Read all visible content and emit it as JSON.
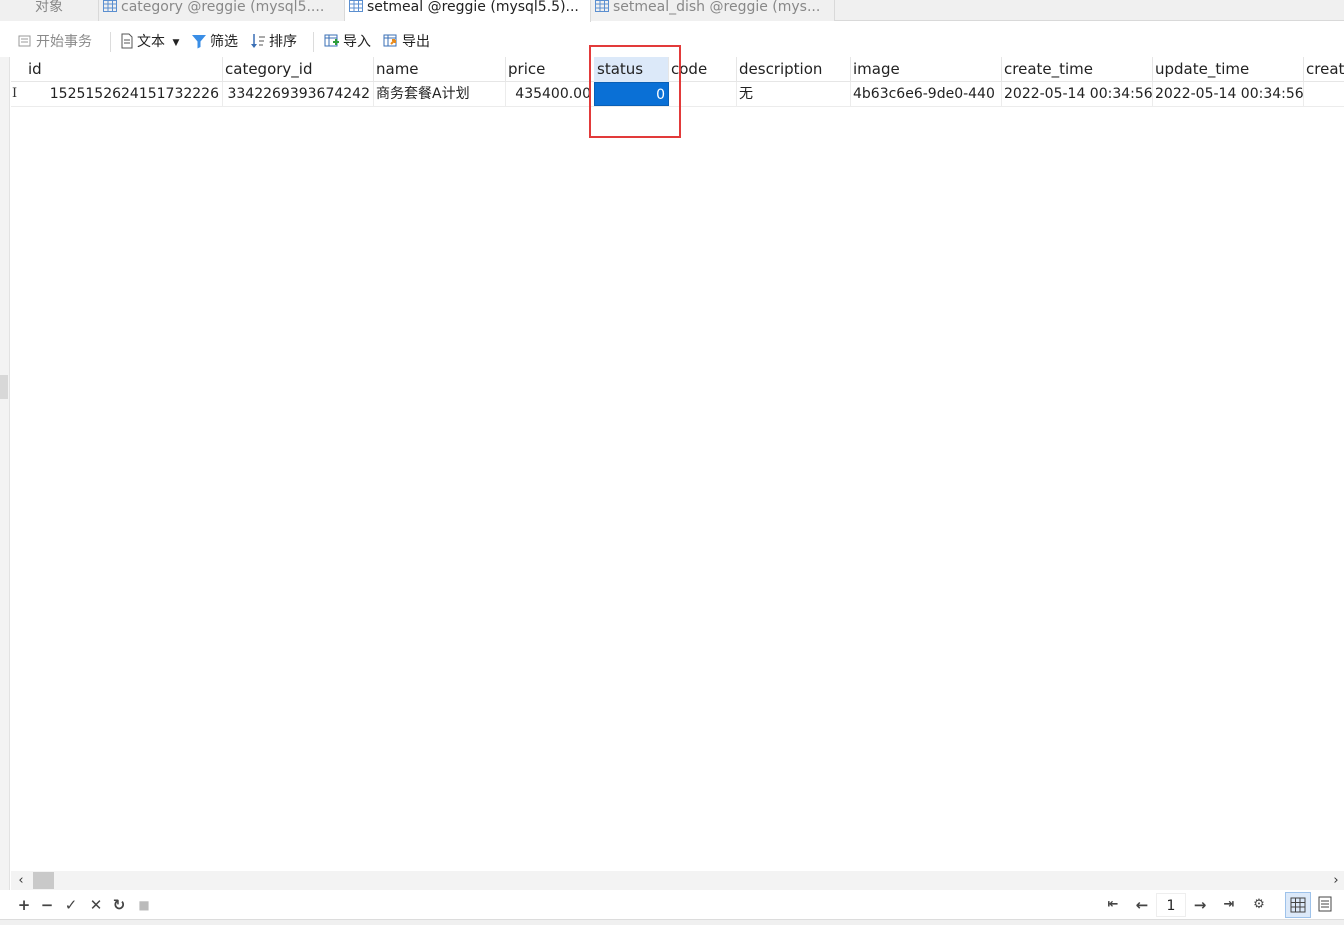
{
  "tabs": [
    {
      "label": "对象",
      "active": false
    },
    {
      "label": "category @reggie (mysql5....",
      "active": false
    },
    {
      "label": "setmeal @reggie (mysql5.5)...",
      "active": true
    },
    {
      "label": "setmeal_dish @reggie (mys...",
      "active": false
    }
  ],
  "toolbar": {
    "begin_transaction": "开始事务",
    "text": "文本",
    "filter": "筛选",
    "sort": "排序",
    "import": "导入",
    "export": "导出"
  },
  "columns": [
    "id",
    "category_id",
    "name",
    "price",
    "status",
    "code",
    "description",
    "image",
    "create_time",
    "update_time",
    "creat"
  ],
  "rows": [
    {
      "marker": "I",
      "cells": [
        "1525152624151732226",
        "3342269393674242",
        "商务套餐A计划",
        "435400.00",
        "0",
        "",
        "无",
        "4b63c6e6-9de0-440",
        "2022-05-14 00:34:56",
        "2022-05-14 00:34:56",
        ""
      ]
    }
  ],
  "selected_column": "status",
  "pagination": {
    "current_page": "1"
  },
  "colors": {
    "selection": "#0a70d6",
    "header_selected": "#dce9f9",
    "highlight_box": "#e23a3a"
  }
}
